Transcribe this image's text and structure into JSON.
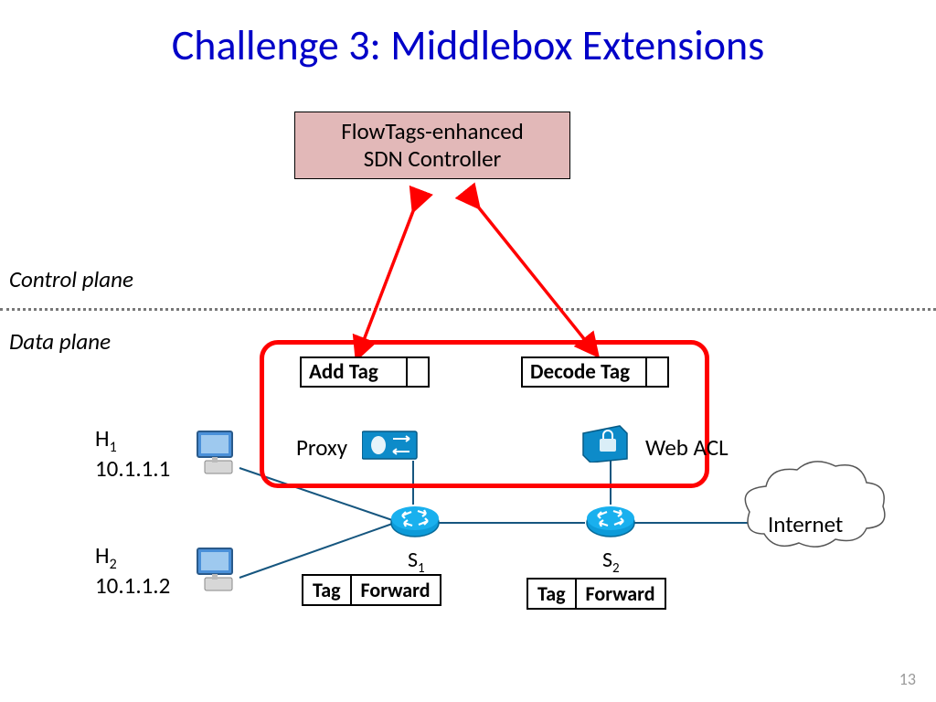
{
  "title": "Challenge 3: Middlebox Extensions",
  "controller": "FlowTags-enhanced\nSDN Controller",
  "planes": {
    "control": "Control plane",
    "data": "Data plane"
  },
  "hosts": {
    "h1": {
      "name": "H",
      "sub": "1",
      "ip": "10.1.1.1"
    },
    "h2": {
      "name": "H",
      "sub": "2",
      "ip": "10.1.1.2"
    }
  },
  "middlebox": {
    "add_tag": "Add Tag",
    "decode_tag": "Decode Tag",
    "proxy": "Proxy",
    "webacl": "Web ACL"
  },
  "switches": {
    "s1": {
      "name": "S",
      "sub": "1"
    },
    "s2": {
      "name": "S",
      "sub": "2"
    }
  },
  "forward_table": {
    "tag": "Tag",
    "forward": "Forward"
  },
  "internet": "Internet",
  "page": "13"
}
